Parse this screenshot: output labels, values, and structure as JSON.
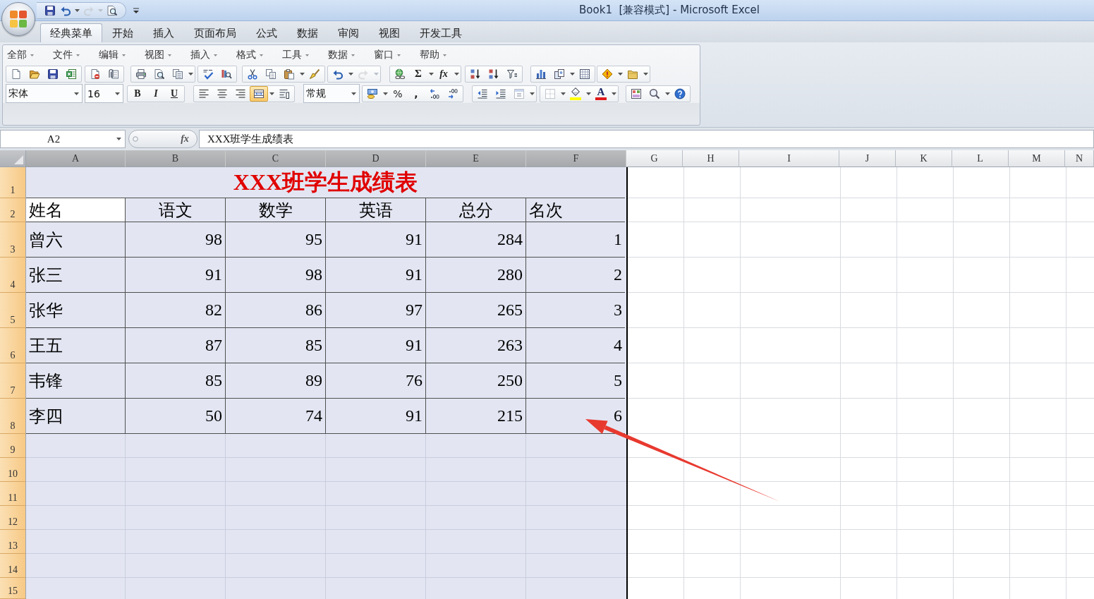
{
  "window": {
    "title": "Book1  [兼容模式] - Microsoft Excel"
  },
  "quick_access_toolbar": [
    {
      "kind": "save",
      "disabled": false
    },
    {
      "kind": "undo",
      "disabled": false
    },
    {
      "kind": "redo",
      "disabled": true
    },
    {
      "kind": "print-preview",
      "disabled": false
    }
  ],
  "ribbon_tabs": [
    {
      "label": "经典菜单",
      "selected": true
    },
    {
      "label": "开始",
      "selected": false
    },
    {
      "label": "插入",
      "selected": false
    },
    {
      "label": "页面布局",
      "selected": false
    },
    {
      "label": "公式",
      "selected": false
    },
    {
      "label": "数据",
      "selected": false
    },
    {
      "label": "审阅",
      "selected": false
    },
    {
      "label": "视图",
      "selected": false
    },
    {
      "label": "开发工具",
      "selected": false
    }
  ],
  "classic_menu": [
    "全部",
    "文件",
    "编辑",
    "视图",
    "插入",
    "格式",
    "工具",
    "数据",
    "窗口",
    "帮助"
  ],
  "standard_toolbar": {
    "history_buttons": [
      {
        "kind": "undo",
        "disabled": false
      },
      {
        "kind": "redo",
        "disabled": true
      }
    ],
    "autosum_label": "Σ",
    "function_label": "fx"
  },
  "formatting_toolbar": {
    "font_name": "宋体",
    "font_size": "16",
    "style_buttons": [
      {
        "kind": "bold",
        "label": "B",
        "on": false
      },
      {
        "kind": "italic",
        "label": "I",
        "on": false
      },
      {
        "kind": "underline",
        "label": "U",
        "on": false
      }
    ],
    "alignment_buttons": [
      {
        "kind": "left",
        "on": false
      },
      {
        "kind": "center",
        "on": false
      },
      {
        "kind": "right",
        "on": false
      },
      {
        "kind": "merge",
        "on": true
      }
    ],
    "number_format": "常规",
    "number_symbols": [
      "%",
      ","
    ],
    "color_buttons": [
      {
        "kind": "fill",
        "color": "#ffff00"
      },
      {
        "kind": "font",
        "label": "A",
        "color": "#e0191b"
      }
    ]
  },
  "formula_bar": {
    "name_box": "A2",
    "function_label": "fx",
    "formula": "XXX班学生成绩表"
  },
  "sheet": {
    "columns": [
      {
        "label": "A",
        "selected": true
      },
      {
        "label": "B",
        "selected": true
      },
      {
        "label": "C",
        "selected": true
      },
      {
        "label": "D",
        "selected": true
      },
      {
        "label": "E",
        "selected": true
      },
      {
        "label": "F",
        "selected": true
      },
      {
        "label": "G",
        "selected": false
      },
      {
        "label": "H",
        "selected": false
      },
      {
        "label": "I",
        "selected": false
      },
      {
        "label": "J",
        "selected": false
      },
      {
        "label": "K",
        "selected": false
      },
      {
        "label": "L",
        "selected": false
      },
      {
        "label": "M",
        "selected": false
      },
      {
        "label": "N",
        "selected": false
      }
    ],
    "rows": [
      {
        "label": "1",
        "selected": true,
        "kind": "title",
        "title": "XXX班学生成绩表"
      },
      {
        "label": "2",
        "selected": true,
        "kind": "header",
        "cells": [
          {
            "text": "姓名",
            "active": true
          },
          {
            "text": "语文",
            "active": false
          },
          {
            "text": "数学",
            "active": false
          },
          {
            "text": "英语",
            "active": false
          },
          {
            "text": "总分",
            "active": false
          },
          {
            "text": "名次",
            "active": false
          }
        ]
      },
      {
        "label": "3",
        "selected": true,
        "kind": "data",
        "cells": [
          {
            "text": "曾六",
            "active": false
          },
          {
            "text": "98",
            "active": false
          },
          {
            "text": "95",
            "active": false
          },
          {
            "text": "91",
            "active": false
          },
          {
            "text": "284",
            "active": false
          },
          {
            "text": "1",
            "active": false
          }
        ]
      },
      {
        "label": "4",
        "selected": true,
        "kind": "data",
        "cells": [
          {
            "text": "张三",
            "active": false
          },
          {
            "text": "91",
            "active": false
          },
          {
            "text": "98",
            "active": false
          },
          {
            "text": "91",
            "active": false
          },
          {
            "text": "280",
            "active": false
          },
          {
            "text": "2",
            "active": false
          }
        ]
      },
      {
        "label": "5",
        "selected": true,
        "kind": "data",
        "cells": [
          {
            "text": "张华",
            "active": false
          },
          {
            "text": "82",
            "active": false
          },
          {
            "text": "86",
            "active": false
          },
          {
            "text": "97",
            "active": false
          },
          {
            "text": "265",
            "active": false
          },
          {
            "text": "3",
            "active": false
          }
        ]
      },
      {
        "label": "6",
        "selected": true,
        "kind": "data",
        "cells": [
          {
            "text": "王五",
            "active": false
          },
          {
            "text": "87",
            "active": false
          },
          {
            "text": "85",
            "active": false
          },
          {
            "text": "91",
            "active": false
          },
          {
            "text": "263",
            "active": false
          },
          {
            "text": "4",
            "active": false
          }
        ]
      },
      {
        "label": "7",
        "selected": true,
        "kind": "data",
        "cells": [
          {
            "text": "韦锋",
            "active": false
          },
          {
            "text": "85",
            "active": false
          },
          {
            "text": "89",
            "active": false
          },
          {
            "text": "76",
            "active": false
          },
          {
            "text": "250",
            "active": false
          },
          {
            "text": "5",
            "active": false
          }
        ]
      },
      {
        "label": "8",
        "selected": true,
        "kind": "data",
        "cells": [
          {
            "text": "李四",
            "active": false
          },
          {
            "text": "50",
            "active": false
          },
          {
            "text": "74",
            "active": false
          },
          {
            "text": "91",
            "active": false
          },
          {
            "text": "215",
            "active": false
          },
          {
            "text": "6",
            "active": false
          }
        ]
      },
      {
        "label": "9",
        "selected": true,
        "kind": "empty"
      },
      {
        "label": "10",
        "selected": true,
        "kind": "empty"
      },
      {
        "label": "11",
        "selected": true,
        "kind": "empty"
      },
      {
        "label": "12",
        "selected": true,
        "kind": "empty"
      },
      {
        "label": "13",
        "selected": true,
        "kind": "empty"
      },
      {
        "label": "14",
        "selected": true,
        "kind": "empty"
      },
      {
        "label": "15",
        "selected": true,
        "kind": "empty"
      }
    ]
  },
  "annotations": [
    {
      "kind": "arrow"
    }
  ]
}
